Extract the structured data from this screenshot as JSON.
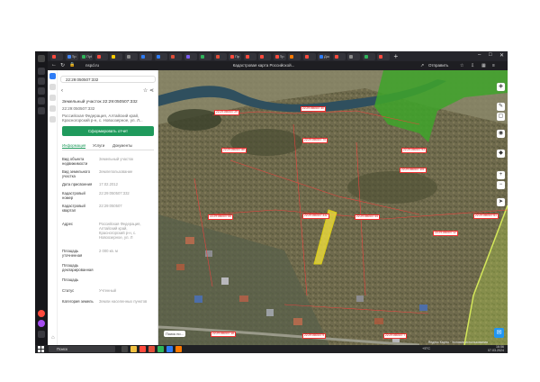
{
  "browser": {
    "tabs": [
      {
        "label": "",
        "color": "#ff4a3d"
      },
      {
        "label": "Пр",
        "color": "#4285f4"
      },
      {
        "label": "Публ",
        "color": "#2fb45a"
      },
      {
        "label": "",
        "color": "#ff4a3d"
      },
      {
        "label": "",
        "color": "#ffcc00"
      },
      {
        "label": "",
        "color": "#888888"
      },
      {
        "label": "",
        "color": "#2e7cf6"
      },
      {
        "label": "",
        "color": "#2e7cf6"
      },
      {
        "label": "",
        "color": "#e04e39"
      },
      {
        "label": "",
        "color": "#7a5cf0"
      },
      {
        "label": "",
        "color": "#2fb45a"
      },
      {
        "label": "",
        "color": "#e04e39"
      },
      {
        "label": "Пр",
        "color": "#ff4a3d"
      },
      {
        "label": "",
        "color": "#ff4a3d"
      },
      {
        "label": "",
        "color": "#ff4a3d"
      },
      {
        "label": "Пр",
        "color": "#ff4a3d"
      },
      {
        "label": "",
        "color": "#ff7a00"
      },
      {
        "label": "",
        "color": "#ff4a3d"
      },
      {
        "label": "Доо",
        "color": "#2e7cf6"
      },
      {
        "label": "",
        "color": "#ff4a3d"
      },
      {
        "label": "",
        "color": "#888888"
      },
      {
        "label": "",
        "color": "#2fb45a"
      },
      {
        "label": "",
        "color": "#ff4a3d"
      }
    ],
    "url": "nspd.ru",
    "page_title": "Кадастровая карта Российской...",
    "share_label": "Отправить"
  },
  "panel": {
    "search_value": "22:29:050507:332",
    "object_title": "Земельный участок 22:29:050507:332",
    "object_number": "22:29:050507:332",
    "address_line1": "Российская Федерация, Алтайский край,",
    "address_line2": "Красногорский р-н, с. Новоозерное, ул. Л...",
    "action_button": "Сформировать отчет",
    "tabs": [
      "Информация",
      "Услуги",
      "Документы"
    ],
    "rows": [
      {
        "label": "Вид объекта недвижимости",
        "value": "Земельный участок"
      },
      {
        "label": "Вид земельного участка",
        "value": "Землепользование"
      },
      {
        "label": "Дата присвоения",
        "value": "17.02.2012"
      },
      {
        "label": "Кадастровый номер",
        "value": "22:29:050507:332"
      },
      {
        "label": "Кадастровый квартал",
        "value": "22:29:050507"
      },
      {
        "label": "Адрес",
        "value": "Российская Федерация, Алтайский край, Красногорский р-н, с. Новоозерное, ул. Л"
      },
      {
        "label": "Площадь уточненная",
        "value": "2 000 кв. м"
      },
      {
        "label": "Площадь декларированная",
        "value": ""
      },
      {
        "label": "Площадь",
        "value": ""
      },
      {
        "label": "Статус",
        "value": "Учтенный"
      },
      {
        "label": "Категория земель",
        "value": "Земли населенных пунктов"
      }
    ]
  },
  "map": {
    "search_here_label": "Поиск по...",
    "attribution": "Яндекс Карты · Условия использования",
    "parcel_labels": [
      "22:29:050507:29",
      "22:29:050507:30",
      "22:29:050507:74",
      "22:29:050507:88",
      "22:29:050507:93",
      "22:29:050507:101",
      "22:29:050507:332",
      "22:29:050507:55",
      "22:29:050507:12",
      "22:29:050507:44",
      "22:29:050507:61",
      "22:29:050507:18",
      "22:29:050507:9",
      "22:29:050507:7"
    ]
  },
  "taskbar": {
    "search_placeholder": "Поиск",
    "weather": "+5°C",
    "time": "16:56",
    "date": "07.03.2024"
  }
}
